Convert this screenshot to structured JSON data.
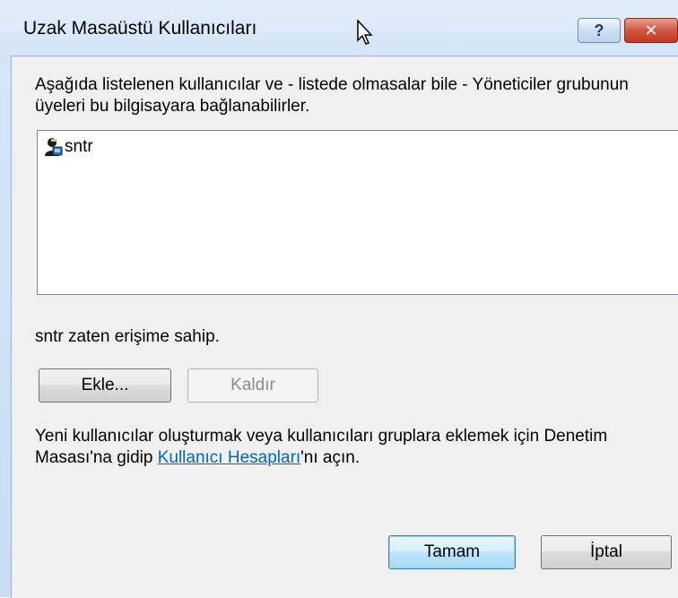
{
  "window": {
    "title": "Uzak Masaüstü Kullanıcıları",
    "help_label": "?",
    "close_label": "✕"
  },
  "dialog": {
    "description": "Aşağıda listelenen kullanıcılar ve - listede olmasalar bile - Yöneticiler grubunun üyeleri bu bilgisayara bağlanabilirler.",
    "users": [
      {
        "name": "sntr",
        "icon": "user-icon"
      }
    ],
    "status": "sntr zaten erişime sahip.",
    "add_button": "Ekle...",
    "remove_button": "Kaldır",
    "info_before": "Yeni kullanıcılar oluşturmak veya kullanıcıları gruplara eklemek için Denetim Masası'na gidip ",
    "info_link": "Kullanıcı Hesapları",
    "info_after": "'nı açın.",
    "ok_button": "Tamam",
    "cancel_button": "İptal"
  },
  "colors": {
    "frame": "#c8dcf2",
    "client": "#f0f0f0",
    "close_button": "#c23a22",
    "link": "#0066cc",
    "default_button_border": "#3c7fb1"
  }
}
